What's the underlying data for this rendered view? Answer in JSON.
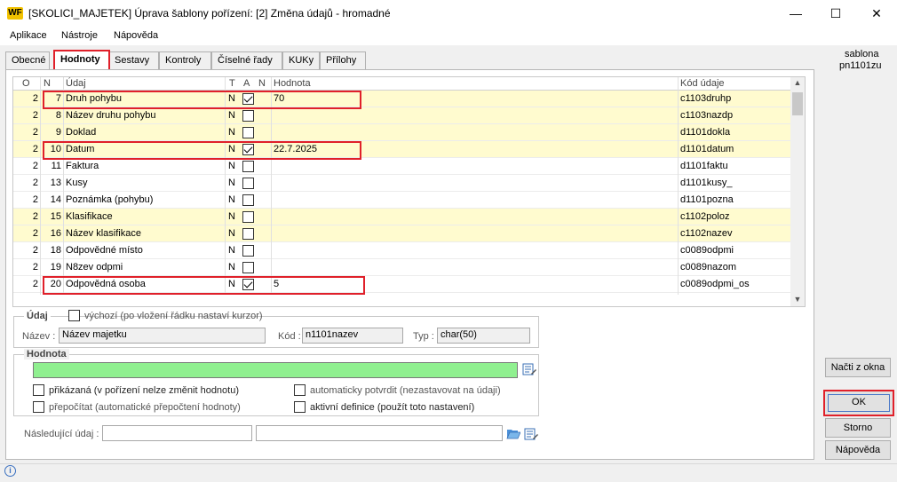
{
  "window": {
    "app_icon": "WF",
    "title": "[SKOLICI_MAJETEK] Úprava šablony pořízení: [2] Změna údajů - hromadné",
    "minimize": "—",
    "maximize": "☐",
    "close": "✕"
  },
  "menu": [
    "Aplikace",
    "Nástroje",
    "Nápověda"
  ],
  "tabs": [
    "Obecné",
    "Hodnoty",
    "Sestavy",
    "Kontroly",
    "Číselné řady",
    "KUKy",
    "Přílohy"
  ],
  "active_tab": "Hodnoty",
  "right_info": {
    "line1": "sablona",
    "line2": "pn1101zu"
  },
  "grid": {
    "headers": {
      "o": "O",
      "n": "N",
      "udaj": "Údaj",
      "t": "T",
      "a": "A",
      "n2": "N",
      "hodnota": "Hodnota",
      "kod": "Kód údaje"
    },
    "rows": [
      {
        "o": "2",
        "n": "7",
        "udaj": "Druh pohybu",
        "t": "N",
        "a": true,
        "hodnota": "70",
        "kod": "c1103druhp",
        "hl": true
      },
      {
        "o": "2",
        "n": "8",
        "udaj": "Název druhu pohybu",
        "t": "N",
        "a": false,
        "hodnota": "",
        "kod": "c1103nazdp",
        "hl": true
      },
      {
        "o": "2",
        "n": "9",
        "udaj": "Doklad",
        "t": "N",
        "a": false,
        "hodnota": "",
        "kod": "d1101dokla",
        "hl": true
      },
      {
        "o": "2",
        "n": "10",
        "udaj": "Datum",
        "t": "N",
        "a": true,
        "hodnota": "22.7.2025",
        "kod": "d1101datum",
        "hl": true
      },
      {
        "o": "2",
        "n": "11",
        "udaj": "Faktura",
        "t": "N",
        "a": false,
        "hodnota": "",
        "kod": "d1101faktu",
        "hl": false
      },
      {
        "o": "2",
        "n": "13",
        "udaj": "Kusy",
        "t": "N",
        "a": false,
        "hodnota": "",
        "kod": "d1101kusy_",
        "hl": false
      },
      {
        "o": "2",
        "n": "14",
        "udaj": "Poznámka (pohybu)",
        "t": "N",
        "a": false,
        "hodnota": "",
        "kod": "d1101pozna",
        "hl": false
      },
      {
        "o": "2",
        "n": "15",
        "udaj": "Klasifikace",
        "t": "N",
        "a": false,
        "hodnota": "",
        "kod": "c1102poloz",
        "hl": true
      },
      {
        "o": "2",
        "n": "16",
        "udaj": "Název klasifikace",
        "t": "N",
        "a": false,
        "hodnota": "",
        "kod": "c1102nazev",
        "hl": true
      },
      {
        "o": "2",
        "n": "18",
        "udaj": "Odpovědné místo",
        "t": "N",
        "a": false,
        "hodnota": "",
        "kod": "c0089odpmi",
        "hl": false
      },
      {
        "o": "2",
        "n": "19",
        "udaj": "N8zev odpmi",
        "t": "N",
        "a": false,
        "hodnota": "",
        "kod": "c0089nazom",
        "hl": false
      },
      {
        "o": "2",
        "n": "20",
        "udaj": "Odpovědná osoba",
        "t": "N",
        "a": true,
        "hodnota": "5",
        "kod": "c0089odpmi_os",
        "hl": false
      }
    ]
  },
  "udaj_group": {
    "title": "Údaj",
    "vychozi_label": "výchozí (po vložení řádku nastaví kurzor)",
    "nazev_label": "Název :",
    "nazev_value": "Název majetku",
    "kod_label": "Kód :",
    "kod_value": "n1101nazev",
    "typ_label": "Typ :",
    "typ_value": "char(50)"
  },
  "hodnota_group": {
    "title": "Hodnota",
    "value": "",
    "prikazana": "přikázaná (v pořízení nelze změnit hodnotu)",
    "prepocitat": "přepočítat (automatické přepočtení hodnoty)",
    "auto_potvrdit": "automaticky potvrdit (nezastavovat na údaji)",
    "aktivni_def": "aktivní definice (použít toto nastavení)"
  },
  "nasledujici_label": "Následující údaj :",
  "buttons": {
    "nacti": "Načti z okna",
    "ok": "OK",
    "storno": "Storno",
    "napoveda": "Nápověda"
  },
  "colors": {
    "highlight_row": "#fffbcf",
    "hodnota_field": "#90f090",
    "red_annotation": "#e0202a"
  }
}
